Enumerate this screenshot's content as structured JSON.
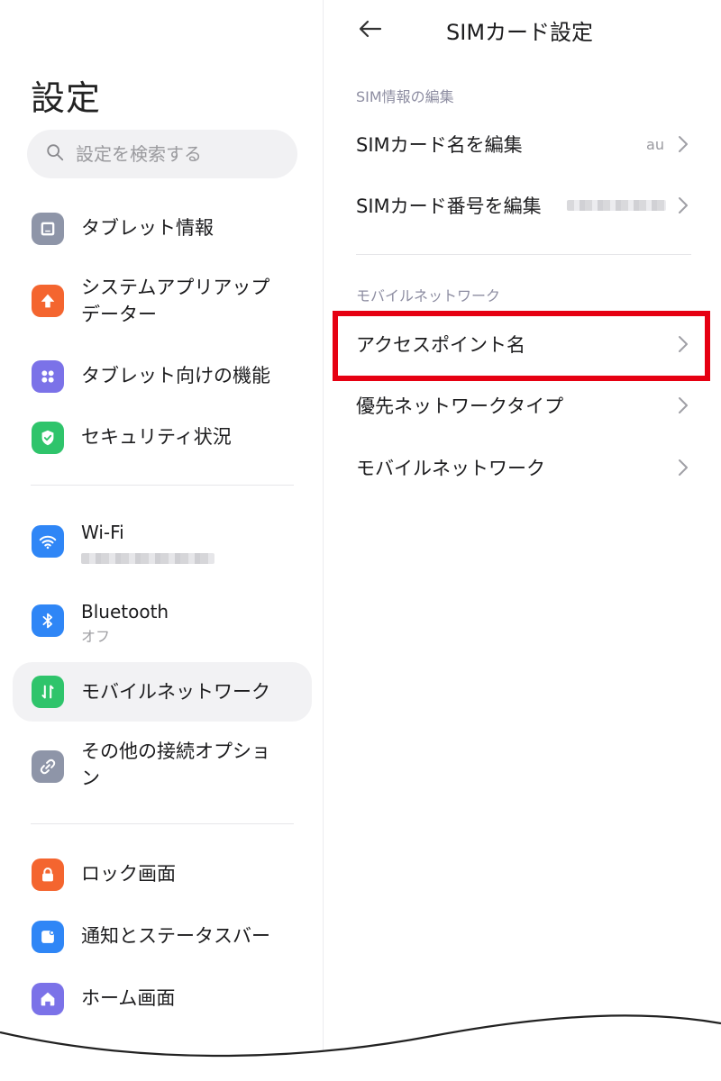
{
  "left": {
    "title": "設定",
    "search_placeholder": "設定を検索する",
    "items": [
      {
        "label": "タブレット情報",
        "color": "#8e95a8",
        "icon": "tablet-icon"
      },
      {
        "label": "システムアプリアップデーター",
        "color": "#f4652f",
        "icon": "arrow-up-icon"
      },
      {
        "label": "タブレット向けの機能",
        "color": "#7b72e8",
        "icon": "grid-dots-icon"
      },
      {
        "label": "セキュリティ状況",
        "color": "#2fc46b",
        "icon": "shield-check-icon"
      },
      {
        "label": "Wi-Fi",
        "sub": "",
        "color": "#2f86f6",
        "icon": "wifi-icon"
      },
      {
        "label": "Bluetooth",
        "sub": "オフ",
        "color": "#2f86f6",
        "icon": "bluetooth-icon"
      },
      {
        "label": "モバイルネットワーク",
        "color": "#2fc46b",
        "icon": "mobile-data-icon"
      },
      {
        "label": "その他の接続オプション",
        "color": "#8e95a8",
        "icon": "link-icon"
      },
      {
        "label": "ロック画面",
        "color": "#f4652f",
        "icon": "lock-icon"
      },
      {
        "label": "通知とステータスバー",
        "color": "#2f86f6",
        "icon": "notification-icon"
      },
      {
        "label": "ホーム画面",
        "color": "#7b72e8",
        "icon": "home-icon"
      }
    ]
  },
  "right": {
    "title": "SIMカード設定",
    "section1": "SIM情報の編集",
    "row_edit_name": {
      "label": "SIMカード名を編集",
      "value": "au"
    },
    "row_edit_number": {
      "label": "SIMカード番号を編集"
    },
    "section2": "モバイルネットワーク",
    "row_apn": {
      "label": "アクセスポイント名"
    },
    "row_pref_network": {
      "label": "優先ネットワークタイプ"
    },
    "row_mobile_network": {
      "label": "モバイルネットワーク"
    }
  },
  "highlight_color": "#e60012"
}
